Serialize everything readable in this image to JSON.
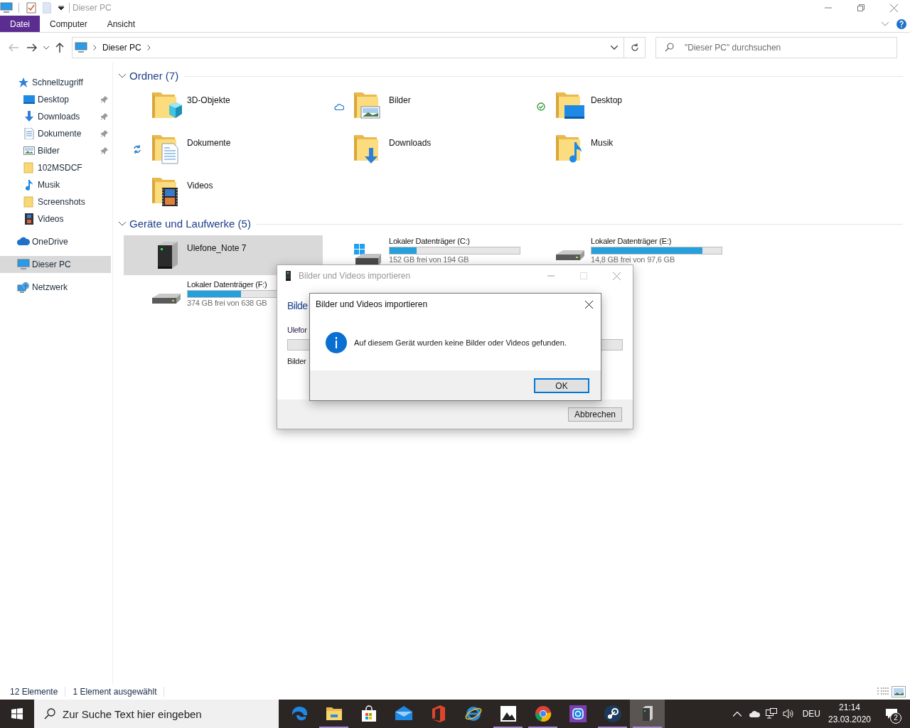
{
  "window": {
    "title": "Dieser PC"
  },
  "file_tab": "Datei",
  "ribbon_tabs": [
    "Computer",
    "Ansicht"
  ],
  "address": {
    "crumbs": [
      "Dieser PC"
    ]
  },
  "search": {
    "placeholder": "\"Dieser PC\" durchsuchen"
  },
  "nav": [
    {
      "kind": "star",
      "label": "Schnellzugriff",
      "selected": false,
      "children": [
        {
          "kind": "desktop",
          "label": "Desktop",
          "pinned": true,
          "selected": false
        },
        {
          "kind": "downloads",
          "label": "Downloads",
          "pinned": true,
          "selected": false
        },
        {
          "kind": "documents",
          "label": "Dokumente",
          "pinned": true,
          "selected": false
        },
        {
          "kind": "pictures",
          "label": "Bilder",
          "pinned": true,
          "selected": false
        },
        {
          "kind": "folder",
          "label": "102MSDCF",
          "pinned": false,
          "selected": false
        },
        {
          "kind": "music",
          "label": "Musik",
          "pinned": false,
          "selected": false
        },
        {
          "kind": "folder",
          "label": "Screenshots",
          "pinned": false,
          "selected": false
        },
        {
          "kind": "videos",
          "label": "Videos",
          "pinned": false,
          "selected": false
        }
      ]
    },
    {
      "kind": "cloud",
      "label": "OneDrive",
      "selected": false
    },
    {
      "kind": "pc",
      "label": "Dieser PC",
      "selected": true
    },
    {
      "kind": "network",
      "label": "Netzwerk",
      "selected": false
    }
  ],
  "groups": [
    {
      "title": "Ordner (7)",
      "expanded": true,
      "items": [
        {
          "kind": "objects",
          "label": "3D-Objekte",
          "selected": false
        },
        {
          "kind": "pictures",
          "label": "Bilder",
          "status": {
            "kind": "cloud"
          },
          "selected": false
        },
        {
          "kind": "desktop",
          "label": "Desktop",
          "status": {
            "kind": "synced"
          },
          "selected": false
        },
        {
          "kind": "documents",
          "label": "Dokumente",
          "status": {
            "kind": "syncing"
          },
          "selected": false
        },
        {
          "kind": "downloads",
          "label": "Downloads",
          "selected": false
        },
        {
          "kind": "music",
          "label": "Musik",
          "selected": false
        },
        {
          "kind": "videos",
          "label": "Videos",
          "selected": false
        }
      ]
    },
    {
      "title": "Geräte und Laufwerke (5)",
      "expanded": true,
      "items": [
        {
          "kind": "phone",
          "label": "Ulefone_Note 7",
          "selected": true
        },
        {
          "kind": "system",
          "label": "Lokaler Datenträger (C:)",
          "level": 0.21,
          "caption": "152 GB frei von 194 GB",
          "selected": false
        },
        {
          "kind": "drive",
          "label": "Lokaler Datenträger (E:)",
          "level": 0.85,
          "caption": "14,8 GB frei von 97,6 GB",
          "selected": false
        },
        {
          "kind": "drive",
          "label": "Lokaler Datenträger (F:)",
          "level": 0.41,
          "caption": "374 GB frei von 638 GB",
          "selected": false
        }
      ]
    }
  ],
  "import_dialog": {
    "title": "Bilder und Videos importieren",
    "active": false,
    "heading": "Bilde",
    "device": "Ulefor",
    "status": "Bilder",
    "button": "Abbrechen"
  },
  "message_dialog": {
    "title": "Bilder und Videos importieren",
    "active": true,
    "message": "Auf diesem Gerät wurden keine Bilder oder Videos gefunden.",
    "button": "OK"
  },
  "status_bar": [
    "12 Elemente",
    "1 Element ausgewählt"
  ],
  "taskbar": {
    "search": {
      "placeholder": "Zur Suche Text hier eingeben"
    },
    "apps": [
      {
        "kind": "edge",
        "running": false,
        "active": false
      },
      {
        "kind": "explorer",
        "running": true,
        "active": false
      },
      {
        "kind": "store",
        "running": false,
        "active": false
      },
      {
        "kind": "mail",
        "running": false,
        "active": false
      },
      {
        "kind": "office",
        "running": false,
        "active": false
      },
      {
        "kind": "ie",
        "running": false,
        "active": false
      },
      {
        "kind": "photos",
        "running": true,
        "active": false
      },
      {
        "kind": "chrome",
        "running": true,
        "active": false
      },
      {
        "kind": "instagram",
        "running": false,
        "active": false
      },
      {
        "kind": "steam",
        "running": true,
        "active": false
      },
      {
        "kind": "device",
        "running": true,
        "active": true
      }
    ],
    "language": "DEU",
    "time": "21:14",
    "date": "23.03.2020",
    "notifications": "2"
  }
}
